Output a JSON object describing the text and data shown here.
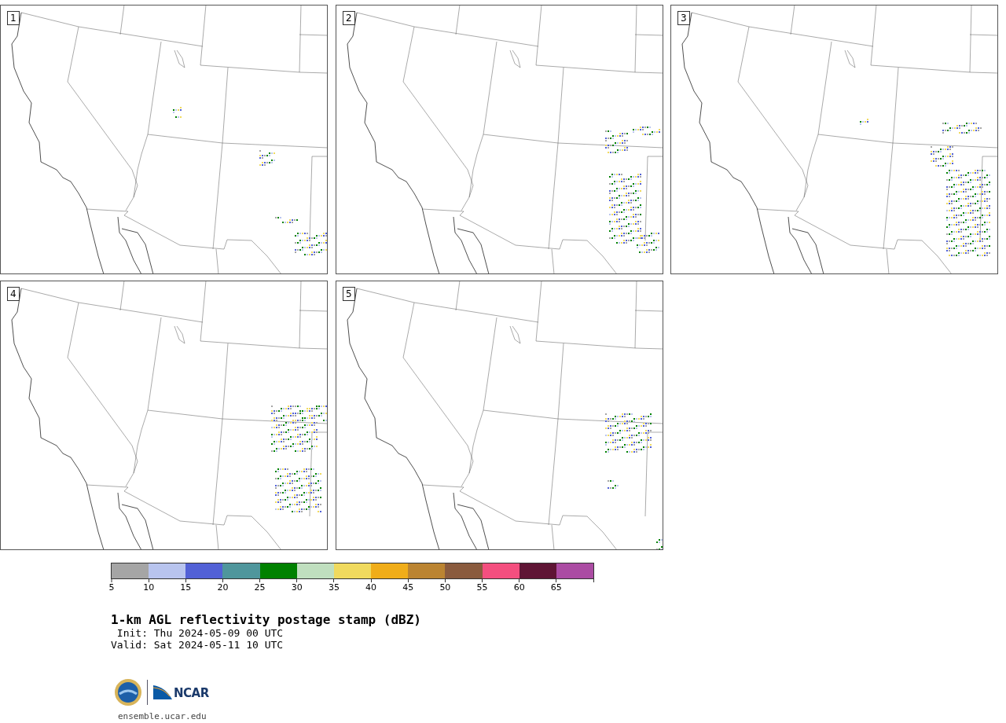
{
  "panels": [
    {
      "number": "1"
    },
    {
      "number": "2"
    },
    {
      "number": "3"
    },
    {
      "number": "4"
    },
    {
      "number": "5"
    }
  ],
  "colorbar": {
    "bins": [
      {
        "color": "#a5a5a5",
        "label": "5"
      },
      {
        "color": "#b8c4ee",
        "label": "10"
      },
      {
        "color": "#5261d6",
        "label": "15"
      },
      {
        "color": "#4f969c",
        "label": "20"
      },
      {
        "color": "#008100",
        "label": "25"
      },
      {
        "color": "#c0dfbf",
        "label": "30"
      },
      {
        "color": "#f0da5e",
        "label": "35"
      },
      {
        "color": "#f0ad19",
        "label": "40"
      },
      {
        "color": "#bb8431",
        "label": "45"
      },
      {
        "color": "#8a5b3e",
        "label": "50"
      },
      {
        "color": "#f44f7f",
        "label": "55"
      },
      {
        "color": "#5f1535",
        "label": "60"
      },
      {
        "color": "#ab4ca3",
        "label": "65"
      }
    ]
  },
  "title": "1-km AGL reflectivity postage stamp (dBZ)",
  "init": " Init: Thu 2024-05-09 00 UTC",
  "valid": "Valid: Sat 2024-05-11 10 UTC",
  "footer": {
    "url": "ensemble.ucar.edu",
    "logo_text": "NCAR"
  }
}
